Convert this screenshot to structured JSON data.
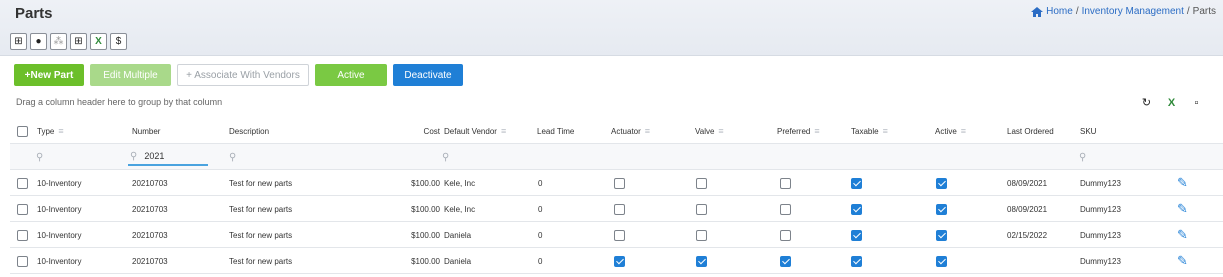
{
  "page": {
    "title": "Parts"
  },
  "breadcrumb": {
    "home": "Home",
    "sep1": "/",
    "section": "Inventory Management",
    "sep2": "/",
    "current": "Parts"
  },
  "toolbar_icons": [
    "grid-icon",
    "help-icon",
    "columns-icon",
    "table-icon",
    "excel-export-icon",
    "dollar-icon"
  ],
  "actions": {
    "new_part": "+New Part",
    "edit_multiple": "Edit Multiple",
    "associate_vendors": "+ Associate With Vendors",
    "active": "Active",
    "deactivate": "Deactivate"
  },
  "grid": {
    "group_hint": "Drag a column header here to group by that column",
    "columns": {
      "type": "Type",
      "number": "Number",
      "description": "Description",
      "cost": "Cost",
      "vendor": "Default Vendor",
      "lead": "Lead Time",
      "actuator": "Actuator",
      "valve": "Valve",
      "preferred": "Preferred",
      "taxable": "Taxable",
      "active": "Active",
      "last_ordered": "Last Ordered",
      "sku": "SKU"
    },
    "filter": {
      "number": "2021"
    },
    "rows": [
      {
        "type": "10-Inventory",
        "number": "20210703",
        "description": "Test for new parts",
        "cost": "$100.00",
        "vendor": "Kele, Inc",
        "lead": "0",
        "actuator": false,
        "valve": false,
        "preferred": false,
        "taxable": true,
        "active": true,
        "last_ordered": "08/09/2021",
        "sku": "Dummy123"
      },
      {
        "type": "10-Inventory",
        "number": "20210703",
        "description": "Test for new parts",
        "cost": "$100.00",
        "vendor": "Kele, Inc",
        "lead": "0",
        "actuator": false,
        "valve": false,
        "preferred": false,
        "taxable": true,
        "active": true,
        "last_ordered": "08/09/2021",
        "sku": "Dummy123"
      },
      {
        "type": "10-Inventory",
        "number": "20210703",
        "description": "Test for new parts",
        "cost": "$100.00",
        "vendor": "Daniela",
        "lead": "0",
        "actuator": false,
        "valve": false,
        "preferred": false,
        "taxable": true,
        "active": true,
        "last_ordered": "02/15/2022",
        "sku": "Dummy123"
      },
      {
        "type": "10-Inventory",
        "number": "20210703",
        "description": "Test for new parts",
        "cost": "$100.00",
        "vendor": "Daniela",
        "lead": "0",
        "actuator": true,
        "valve": true,
        "preferred": true,
        "taxable": true,
        "active": true,
        "last_ordered": "",
        "sku": "Dummy123"
      }
    ]
  },
  "colors": {
    "accent_blue": "#1f7fd6",
    "green": "#6cbf2a"
  }
}
